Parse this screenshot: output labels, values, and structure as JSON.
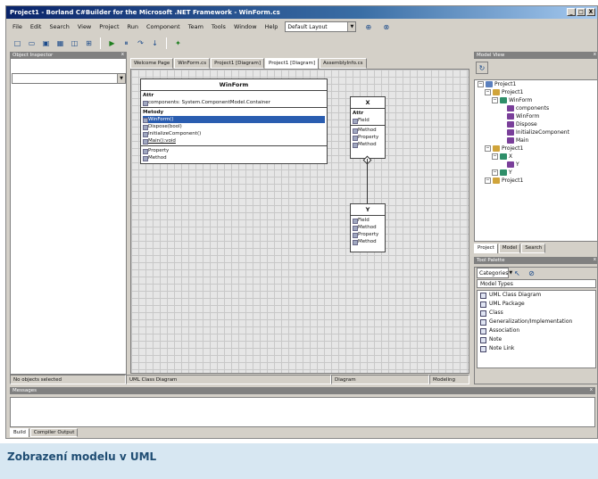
{
  "window": {
    "title": "Project1 - Borland C#Builder for the Microsoft .NET Framework - WinForm.cs",
    "controls": [
      "_",
      "□",
      "X"
    ]
  },
  "menubar": {
    "items": [
      "File",
      "Edit",
      "Search",
      "View",
      "Project",
      "Run",
      "Component",
      "Team",
      "Tools",
      "Window",
      "Help"
    ],
    "layout_combo": "Default Layout"
  },
  "toolbar": {
    "icons": [
      "new-icon",
      "open-icon",
      "save-icon",
      "save-all-icon",
      "open-project-icon",
      "add-file-icon",
      "run-icon",
      "pause-icon",
      "step-over-icon",
      "trace-into-icon",
      "help-icon"
    ]
  },
  "left_panel": {
    "title": "Object Inspector",
    "close": "x",
    "combo_value": ""
  },
  "tabs": [
    {
      "label": "Welcome Page"
    },
    {
      "label": "WinForm.cs"
    },
    {
      "label": "Project1 [Diagram]"
    },
    {
      "label": "Project1 [Diagram]"
    },
    {
      "label": "AssemblyInfo.cs"
    }
  ],
  "diagram": {
    "winform": {
      "name": "WinForm",
      "attrs_header": "Attr",
      "attrs": [
        "components: System.ComponentModel.Container"
      ],
      "ops_header": "Metody",
      "ops": [
        "WinForm()",
        "Dispose(bool)",
        "InitializeComponent()",
        "Main():void"
      ],
      "props": [
        "Property",
        "Method"
      ]
    },
    "class_x": {
      "name": "X",
      "attrs_header": "Attr",
      "attrs": [
        "Field"
      ],
      "ops": [
        "Method",
        "Property",
        "Method"
      ]
    },
    "class_y": {
      "name": "Y",
      "attrs": [
        "Field",
        "Method",
        "Property",
        "Method"
      ]
    }
  },
  "statusbar": {
    "left": "No objects selected",
    "middle": "UML Class Diagram",
    "right": "Diagram",
    "flag": "Modeling"
  },
  "right_panel": {
    "title": "Model View",
    "tree": [
      {
        "label": "Project1",
        "level": 0,
        "icon": "proj"
      },
      {
        "label": "Project1",
        "level": 1,
        "icon": "ns"
      },
      {
        "label": "WinForm",
        "level": 2,
        "icon": "cls"
      },
      {
        "label": "components",
        "level": 3,
        "icon": "mem"
      },
      {
        "label": "WinForm",
        "level": 3,
        "icon": "mem"
      },
      {
        "label": "Dispose",
        "level": 3,
        "icon": "mem"
      },
      {
        "label": "InitializeComponent",
        "level": 3,
        "icon": "mem"
      },
      {
        "label": "Main",
        "level": 3,
        "icon": "mem"
      },
      {
        "label": "Project1",
        "level": 1,
        "icon": "ns"
      },
      {
        "label": "X",
        "level": 2,
        "icon": "cls"
      },
      {
        "label": "Y",
        "level": 3,
        "icon": "mem"
      },
      {
        "label": "Y",
        "level": 2,
        "icon": "cls"
      },
      {
        "label": "Project1",
        "level": 1,
        "icon": "ns"
      }
    ],
    "tabs": [
      "Project",
      "Model",
      "Search"
    ]
  },
  "toolbox": {
    "title": "Tool Palette",
    "category": "Categories",
    "filter": "Model Types",
    "items": [
      "UML Class Diagram",
      "UML Package",
      "Class",
      "Generalization/Implementation",
      "Association",
      "Note",
      "Note Link"
    ]
  },
  "output": {
    "title": "Messages",
    "tabs": [
      "Build",
      "Compiler Output"
    ]
  },
  "caption": {
    "text": "Zobrazení modelu v UML"
  },
  "colors": {
    "accent": "#0a246a",
    "selection": "#2a5db0",
    "caption_bg": "#d7e7f2",
    "caption_text": "#1f4d73"
  }
}
